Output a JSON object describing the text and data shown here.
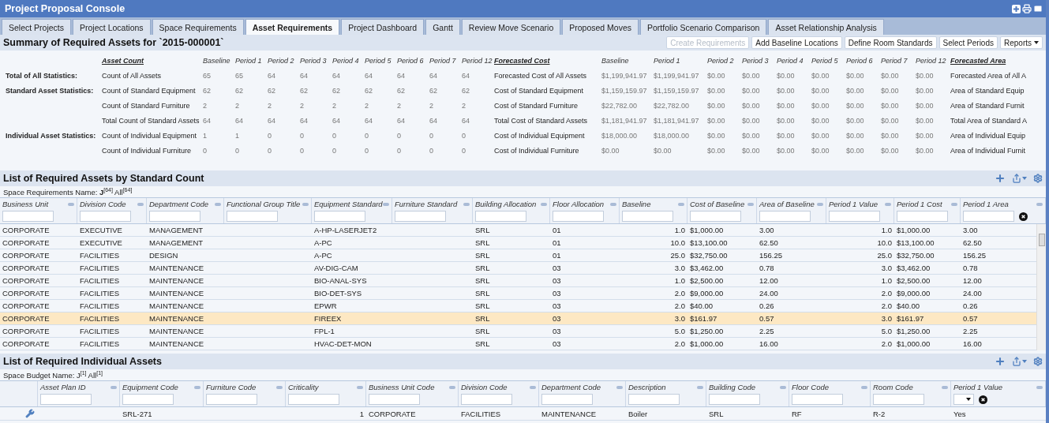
{
  "window": {
    "title": "Project Proposal Console"
  },
  "tabs": [
    {
      "label": "Select Projects",
      "selected": false
    },
    {
      "label": "Project Locations",
      "selected": false
    },
    {
      "label": "Space Requirements",
      "selected": false
    },
    {
      "label": "Asset Requirements",
      "selected": true
    },
    {
      "label": "Project Dashboard",
      "selected": false
    },
    {
      "label": "Gantt",
      "selected": false
    },
    {
      "label": "Review Move Scenario",
      "selected": false
    },
    {
      "label": "Proposed Moves",
      "selected": false
    },
    {
      "label": "Portfolio Scenario Comparison",
      "selected": false
    },
    {
      "label": "Asset Relationship Analysis",
      "selected": false
    }
  ],
  "summary": {
    "title": "Summary of Required Assets for `2015-000001`",
    "buttons": [
      {
        "label": "Create Requirements",
        "disabled": true
      },
      {
        "label": "Add Baseline Locations",
        "disabled": false
      },
      {
        "label": "Define Room Standards",
        "disabled": false
      },
      {
        "label": "Select Periods",
        "disabled": false
      },
      {
        "label": "Reports",
        "disabled": false,
        "kind": "menu"
      }
    ],
    "count_header": "Asset Count",
    "count_periods": [
      "Baseline",
      "Period 1",
      "Period 2",
      "Period 3",
      "Period 4",
      "Period 5",
      "Period 6",
      "Period 7",
      "Period 12"
    ],
    "cost_header": "Forecasted Cost",
    "cost_periods": [
      "Baseline",
      "Period 1",
      "Period 2",
      "Period 3",
      "Period 4",
      "Period 5",
      "Period 6",
      "Period 7",
      "Period 12"
    ],
    "area_header": "Forecasted Area",
    "rows": [
      {
        "group": "Total of All Statistics:",
        "count_label": "Count of All Assets",
        "counts": [
          "65",
          "65",
          "64",
          "64",
          "64",
          "64",
          "64",
          "64",
          "64"
        ],
        "cost_label": "Forecasted Cost of All Assets",
        "costs": [
          "$1,199,941.97",
          "$1,199,941.97",
          "$0.00",
          "$0.00",
          "$0.00",
          "$0.00",
          "$0.00",
          "$0.00",
          "$0.00"
        ],
        "area_label": "Forecasted Area of All A"
      },
      {
        "group": "Standard Asset Statistics:",
        "count_label": "Count of Standard Equipment",
        "counts": [
          "62",
          "62",
          "62",
          "62",
          "62",
          "62",
          "62",
          "62",
          "62"
        ],
        "cost_label": "Cost of Standard Equipment",
        "costs": [
          "$1,159,159.97",
          "$1,159,159.97",
          "$0.00",
          "$0.00",
          "$0.00",
          "$0.00",
          "$0.00",
          "$0.00",
          "$0.00"
        ],
        "area_label": "Area of Standard Equip"
      },
      {
        "count_label": "Count of Standard Furniture",
        "counts": [
          "2",
          "2",
          "2",
          "2",
          "2",
          "2",
          "2",
          "2",
          "2"
        ],
        "cost_label": "Cost of Standard Furniture",
        "costs": [
          "$22,782.00",
          "$22,782.00",
          "$0.00",
          "$0.00",
          "$0.00",
          "$0.00",
          "$0.00",
          "$0.00",
          "$0.00"
        ],
        "area_label": "Area of Standard Furnit"
      },
      {
        "count_label": "Total Count of Standard Assets",
        "counts": [
          "64",
          "64",
          "64",
          "64",
          "64",
          "64",
          "64",
          "64",
          "64"
        ],
        "cost_label": "Total Cost of Standard Assets",
        "costs": [
          "$1,181,941.97",
          "$1,181,941.97",
          "$0.00",
          "$0.00",
          "$0.00",
          "$0.00",
          "$0.00",
          "$0.00",
          "$0.00"
        ],
        "area_label": "Total Area of Standard A"
      },
      {
        "group": "Individual Asset Statistics:",
        "count_label": "Count of Individual Equipment",
        "counts": [
          "1",
          "1",
          "0",
          "0",
          "0",
          "0",
          "0",
          "0",
          "0"
        ],
        "cost_label": "Cost of Individual Equipment",
        "costs": [
          "$18,000.00",
          "$18,000.00",
          "$0.00",
          "$0.00",
          "$0.00",
          "$0.00",
          "$0.00",
          "$0.00",
          "$0.00"
        ],
        "area_label": "Area of Individual Equip"
      },
      {
        "count_label": "Count of Individual Furniture",
        "counts": [
          "0",
          "0",
          "0",
          "0",
          "0",
          "0",
          "0",
          "0",
          "0"
        ],
        "cost_label": "Cost of Individual Furniture",
        "costs": [
          "$0.00",
          "$0.00",
          "$0.00",
          "$0.00",
          "$0.00",
          "$0.00",
          "$0.00",
          "$0.00",
          "$0.00"
        ],
        "area_label": "Area of Individual Furnit"
      }
    ]
  },
  "standard_assets": {
    "title": "List of Required Assets by Standard Count",
    "caption": "Space Requirements Name: **J**$^{[64]}$ All$^{[64]}$",
    "columns": [
      {
        "label": "Business Unit",
        "kind": "text"
      },
      {
        "label": "Division Code",
        "kind": "text"
      },
      {
        "label": "Department Code",
        "kind": "text"
      },
      {
        "label": "Functional Group Title",
        "kind": "text"
      },
      {
        "label": "Equipment Standard",
        "kind": "text"
      },
      {
        "label": "Furniture Standard",
        "kind": "text"
      },
      {
        "label": "Building Allocation",
        "kind": "text"
      },
      {
        "label": "Floor Allocation",
        "kind": "text"
      },
      {
        "label": "Baseline",
        "kind": "number"
      },
      {
        "label": "Cost of Baseline",
        "kind": "text"
      },
      {
        "label": "Area of Baseline",
        "kind": "text"
      },
      {
        "label": "Period 1 Value",
        "kind": "number"
      },
      {
        "label": "Period 1 Cost",
        "kind": "text"
      },
      {
        "label": "Period 1 Area",
        "kind": "text",
        "clear": true
      }
    ],
    "rows": [
      {
        "selected": false,
        "cells": [
          "CORPORATE",
          "EXECUTIVE",
          "MANAGEMENT",
          null,
          "A-HP-LASERJET2",
          null,
          "SRL",
          "01",
          "1.0",
          "$1,000.00",
          "3.00",
          "1.0",
          "$1,000.00",
          "3.00"
        ]
      },
      {
        "selected": false,
        "cells": [
          "CORPORATE",
          "EXECUTIVE",
          "MANAGEMENT",
          null,
          "A-PC",
          null,
          "SRL",
          "01",
          "10.0",
          "$13,100.00",
          "62.50",
          "10.0",
          "$13,100.00",
          "62.50"
        ]
      },
      {
        "selected": false,
        "cells": [
          "CORPORATE",
          "FACILITIES",
          "DESIGN",
          null,
          "A-PC",
          null,
          "SRL",
          "01",
          "25.0",
          "$32,750.00",
          "156.25",
          "25.0",
          "$32,750.00",
          "156.25"
        ]
      },
      {
        "selected": false,
        "cells": [
          "CORPORATE",
          "FACILITIES",
          "MAINTENANCE",
          null,
          "AV-DIG-CAM",
          null,
          "SRL",
          "03",
          "3.0",
          "$3,462.00",
          "0.78",
          "3.0",
          "$3,462.00",
          "0.78"
        ]
      },
      {
        "selected": false,
        "cells": [
          "CORPORATE",
          "FACILITIES",
          "MAINTENANCE",
          null,
          "BIO-ANAL-SYS",
          null,
          "SRL",
          "03",
          "1.0",
          "$2,500.00",
          "12.00",
          "1.0",
          "$2,500.00",
          "12.00"
        ]
      },
      {
        "selected": false,
        "cells": [
          "CORPORATE",
          "FACILITIES",
          "MAINTENANCE",
          null,
          "BIO-DET-SYS",
          null,
          "SRL",
          "03",
          "2.0",
          "$9,000.00",
          "24.00",
          "2.0",
          "$9,000.00",
          "24.00"
        ]
      },
      {
        "selected": false,
        "cells": [
          "CORPORATE",
          "FACILITIES",
          "MAINTENANCE",
          null,
          "EPWR",
          null,
          "SRL",
          "03",
          "2.0",
          "$40.00",
          "0.26",
          "2.0",
          "$40.00",
          "0.26"
        ]
      },
      {
        "selected": true,
        "cells": [
          "CORPORATE",
          "FACILITIES",
          "MAINTENANCE",
          null,
          "FIREEX",
          null,
          "SRL",
          "03",
          "3.0",
          "$161.97",
          "0.57",
          "3.0",
          "$161.97",
          "0.57"
        ]
      },
      {
        "selected": false,
        "cells": [
          "CORPORATE",
          "FACILITIES",
          "MAINTENANCE",
          null,
          "FPL-1",
          null,
          "SRL",
          "03",
          "5.0",
          "$1,250.00",
          "2.25",
          "5.0",
          "$1,250.00",
          "2.25"
        ]
      },
      {
        "selected": false,
        "cells": [
          "CORPORATE",
          "FACILITIES",
          "MAINTENANCE",
          null,
          "HVAC-DET-MON",
          null,
          "SRL",
          "03",
          "2.0",
          "$1,000.00",
          "16.00",
          "2.0",
          "$1,000.00",
          "16.00"
        ]
      }
    ]
  },
  "individual_assets": {
    "title": "List of Required Individual Assets",
    "caption": "Space Budget Name: J$^{[1]}$ All$^{[1]}$",
    "columns": [
      {
        "label": "Asset Plan ID",
        "kind": "text"
      },
      {
        "label": "Equipment Code",
        "kind": "text"
      },
      {
        "label": "Furniture Code",
        "kind": "text"
      },
      {
        "label": "Criticality",
        "kind": "number"
      },
      {
        "label": "Business Unit Code",
        "kind": "text"
      },
      {
        "label": "Division Code",
        "kind": "text"
      },
      {
        "label": "Department Code",
        "kind": "text"
      },
      {
        "label": "Description",
        "kind": "text"
      },
      {
        "label": "Building Code",
        "kind": "text"
      },
      {
        "label": "Floor Code",
        "kind": "text"
      },
      {
        "label": "Room Code",
        "kind": "text"
      },
      {
        "label": "Period 1 Value",
        "kind": "choice",
        "clear": true
      }
    ],
    "rows": [
      {
        "selected": false,
        "cells": [
          null,
          "SRL-271",
          null,
          "1",
          "CORPORATE",
          "FACILITIES",
          "MAINTENANCE",
          "Boiler",
          "SRL",
          "RF",
          "R-2",
          "Yes"
        ]
      }
    ]
  }
}
